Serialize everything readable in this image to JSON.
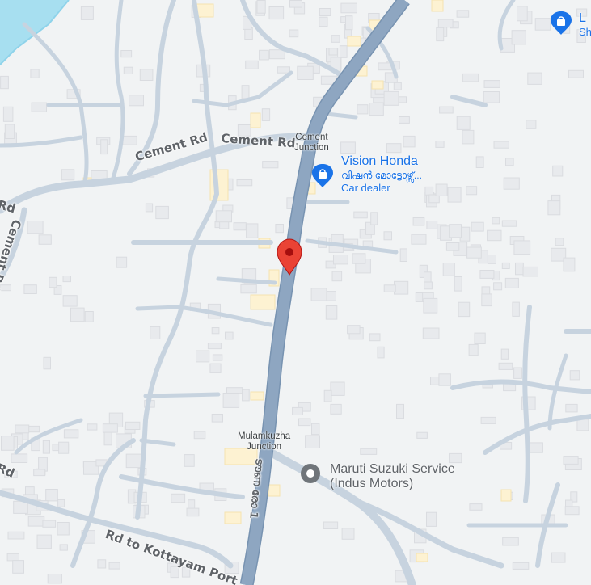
{
  "map": {
    "colors": {
      "background": "#f1f3f4",
      "building": "#e8eaed",
      "building_stroke": "#dadce0",
      "minor_road": "#c7d3df",
      "highway": "#8ea6c1",
      "water": "#a7dff0",
      "commercial": "#fdf2d2",
      "poi_blue": "#1a73e8",
      "poi_gray": "#70757a",
      "marker_red": "#ea4335"
    },
    "road_labels": {
      "cement_rd_left": "Cement Rd",
      "cement_rd_right": "Cement Rd",
      "rd_top_left": "Rd",
      "cement_rd_vertical": "Cement Rd",
      "rd_bottom_left": "Rd",
      "rd_to_kottayam": "Rd to Kottayam Port",
      "highway_malayalam": "ടൗണ രോ 1"
    },
    "junctions": {
      "cement_junction": "Cement\nJunction",
      "mulamkuzha_junction": "Mulamkuzha\nJunction"
    },
    "pois": {
      "vision_honda": {
        "name": "Vision Honda",
        "local_name": "വിഷൻ മോട്ടോഴ്സ്...",
        "category": "Car dealer",
        "icon": "shopping-bag-icon"
      },
      "maruti_suzuki": {
        "name_line1": "Maruti Suzuki Service",
        "name_line2": "(Indus Motors)",
        "icon": "service-dot-icon"
      },
      "top_right_poi": {
        "name": "L",
        "sub": "Sh",
        "icon": "shopping-bag-icon"
      }
    },
    "selected_marker": {
      "icon": "location-pin-icon"
    }
  }
}
